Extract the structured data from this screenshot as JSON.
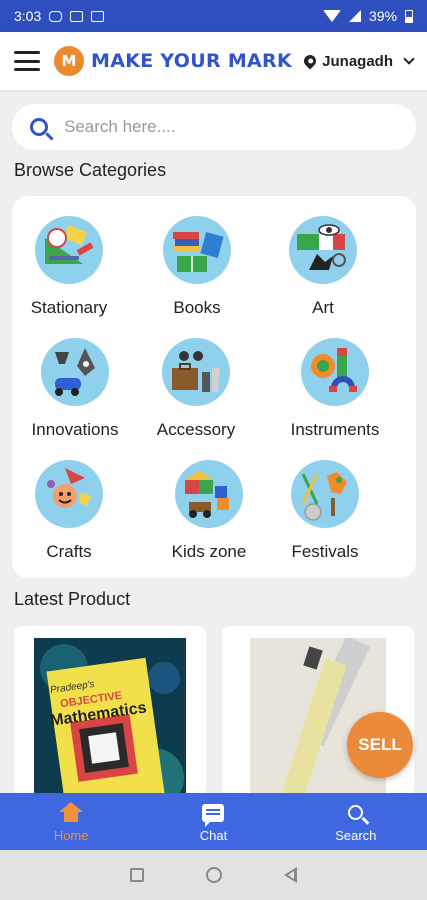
{
  "status_bar": {
    "time": "3:03",
    "battery": "39%",
    "icons": [
      "instagram-icon",
      "mail-icon",
      "laptop-icon",
      "wifi-icon",
      "signal-icon",
      "battery-icon"
    ]
  },
  "app_bar": {
    "logo_letter": "M",
    "brand": "MAKE YOUR MARK",
    "location": "Junagadh",
    "brand_color": "#2f55c8",
    "accent_color": "#e98a2e"
  },
  "search": {
    "placeholder": "Search here...."
  },
  "categories": {
    "title": "Browse Categories",
    "items": [
      {
        "label": "Stationary",
        "icon": "stationary-icon"
      },
      {
        "label": "Books",
        "icon": "books-icon"
      },
      {
        "label": "Art",
        "icon": "art-icon"
      },
      {
        "label": "Innovations",
        "icon": "innovations-icon"
      },
      {
        "label": "Accessory",
        "icon": "accessory-icon"
      },
      {
        "label": "Instruments",
        "icon": "instruments-icon"
      },
      {
        "label": "Crafts",
        "icon": "crafts-icon"
      },
      {
        "label": "Kids zone",
        "icon": "kids-zone-icon"
      },
      {
        "label": "Festivals",
        "icon": "festivals-icon"
      }
    ]
  },
  "latest": {
    "title": "Latest Product",
    "products": [
      {
        "image": "objective-mathematics-book",
        "cover_brand": "Pradeep's",
        "cover_title": "OBJECTIVE",
        "cover_subtitle": "Mathematics"
      },
      {
        "image": "pencil-and-ruler"
      }
    ]
  },
  "fab": {
    "label": "SELL",
    "color": "#ea8a3a"
  },
  "bottom_nav": {
    "items": [
      {
        "label": "Home",
        "active": true
      },
      {
        "label": "Chat",
        "active": false
      },
      {
        "label": "Search",
        "active": false
      }
    ],
    "bar_color": "#3f67e0",
    "active_color": "#f0923a"
  }
}
